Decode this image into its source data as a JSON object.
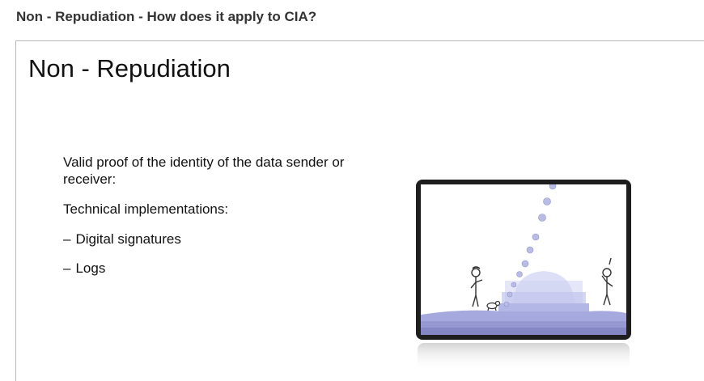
{
  "page": {
    "title": "Non - Repudiation - How does it apply to CIA?"
  },
  "slide": {
    "heading": "Non - Repudiation",
    "line1": "Valid proof of the identity of the data sender or receiver:",
    "line2": "Technical implementations:",
    "bullet_dash": "–",
    "bullets": [
      "Digital signatures",
      "Logs"
    ]
  },
  "illustration": {
    "icon": "video-frame-icon",
    "colors": {
      "frame": "#222222",
      "ball": "#b9bde6",
      "hill": "#aeb2e4",
      "ground": "#8c8fc8",
      "sky": "#ffffff"
    }
  }
}
